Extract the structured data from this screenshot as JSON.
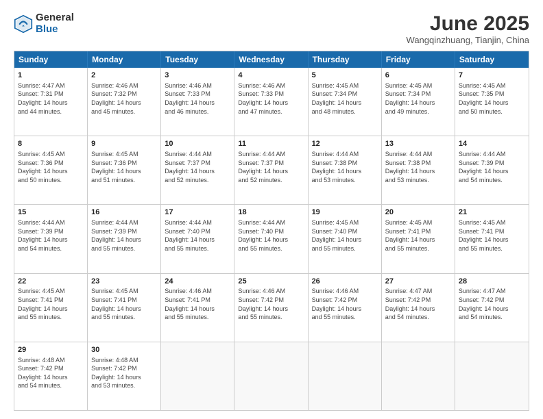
{
  "logo": {
    "general": "General",
    "blue": "Blue"
  },
  "title": "June 2025",
  "location": "Wangqinzhuang, Tianjin, China",
  "header_days": [
    "Sunday",
    "Monday",
    "Tuesday",
    "Wednesday",
    "Thursday",
    "Friday",
    "Saturday"
  ],
  "weeks": [
    [
      {
        "day": 1,
        "lines": [
          "Sunrise: 4:47 AM",
          "Sunset: 7:31 PM",
          "Daylight: 14 hours",
          "and 44 minutes."
        ]
      },
      {
        "day": 2,
        "lines": [
          "Sunrise: 4:46 AM",
          "Sunset: 7:32 PM",
          "Daylight: 14 hours",
          "and 45 minutes."
        ]
      },
      {
        "day": 3,
        "lines": [
          "Sunrise: 4:46 AM",
          "Sunset: 7:33 PM",
          "Daylight: 14 hours",
          "and 46 minutes."
        ]
      },
      {
        "day": 4,
        "lines": [
          "Sunrise: 4:46 AM",
          "Sunset: 7:33 PM",
          "Daylight: 14 hours",
          "and 47 minutes."
        ]
      },
      {
        "day": 5,
        "lines": [
          "Sunrise: 4:45 AM",
          "Sunset: 7:34 PM",
          "Daylight: 14 hours",
          "and 48 minutes."
        ]
      },
      {
        "day": 6,
        "lines": [
          "Sunrise: 4:45 AM",
          "Sunset: 7:34 PM",
          "Daylight: 14 hours",
          "and 49 minutes."
        ]
      },
      {
        "day": 7,
        "lines": [
          "Sunrise: 4:45 AM",
          "Sunset: 7:35 PM",
          "Daylight: 14 hours",
          "and 50 minutes."
        ]
      }
    ],
    [
      {
        "day": 8,
        "lines": [
          "Sunrise: 4:45 AM",
          "Sunset: 7:36 PM",
          "Daylight: 14 hours",
          "and 50 minutes."
        ]
      },
      {
        "day": 9,
        "lines": [
          "Sunrise: 4:45 AM",
          "Sunset: 7:36 PM",
          "Daylight: 14 hours",
          "and 51 minutes."
        ]
      },
      {
        "day": 10,
        "lines": [
          "Sunrise: 4:44 AM",
          "Sunset: 7:37 PM",
          "Daylight: 14 hours",
          "and 52 minutes."
        ]
      },
      {
        "day": 11,
        "lines": [
          "Sunrise: 4:44 AM",
          "Sunset: 7:37 PM",
          "Daylight: 14 hours",
          "and 52 minutes."
        ]
      },
      {
        "day": 12,
        "lines": [
          "Sunrise: 4:44 AM",
          "Sunset: 7:38 PM",
          "Daylight: 14 hours",
          "and 53 minutes."
        ]
      },
      {
        "day": 13,
        "lines": [
          "Sunrise: 4:44 AM",
          "Sunset: 7:38 PM",
          "Daylight: 14 hours",
          "and 53 minutes."
        ]
      },
      {
        "day": 14,
        "lines": [
          "Sunrise: 4:44 AM",
          "Sunset: 7:39 PM",
          "Daylight: 14 hours",
          "and 54 minutes."
        ]
      }
    ],
    [
      {
        "day": 15,
        "lines": [
          "Sunrise: 4:44 AM",
          "Sunset: 7:39 PM",
          "Daylight: 14 hours",
          "and 54 minutes."
        ]
      },
      {
        "day": 16,
        "lines": [
          "Sunrise: 4:44 AM",
          "Sunset: 7:39 PM",
          "Daylight: 14 hours",
          "and 55 minutes."
        ]
      },
      {
        "day": 17,
        "lines": [
          "Sunrise: 4:44 AM",
          "Sunset: 7:40 PM",
          "Daylight: 14 hours",
          "and 55 minutes."
        ]
      },
      {
        "day": 18,
        "lines": [
          "Sunrise: 4:44 AM",
          "Sunset: 7:40 PM",
          "Daylight: 14 hours",
          "and 55 minutes."
        ]
      },
      {
        "day": 19,
        "lines": [
          "Sunrise: 4:45 AM",
          "Sunset: 7:40 PM",
          "Daylight: 14 hours",
          "and 55 minutes."
        ]
      },
      {
        "day": 20,
        "lines": [
          "Sunrise: 4:45 AM",
          "Sunset: 7:41 PM",
          "Daylight: 14 hours",
          "and 55 minutes."
        ]
      },
      {
        "day": 21,
        "lines": [
          "Sunrise: 4:45 AM",
          "Sunset: 7:41 PM",
          "Daylight: 14 hours",
          "and 55 minutes."
        ]
      }
    ],
    [
      {
        "day": 22,
        "lines": [
          "Sunrise: 4:45 AM",
          "Sunset: 7:41 PM",
          "Daylight: 14 hours",
          "and 55 minutes."
        ]
      },
      {
        "day": 23,
        "lines": [
          "Sunrise: 4:45 AM",
          "Sunset: 7:41 PM",
          "Daylight: 14 hours",
          "and 55 minutes."
        ]
      },
      {
        "day": 24,
        "lines": [
          "Sunrise: 4:46 AM",
          "Sunset: 7:41 PM",
          "Daylight: 14 hours",
          "and 55 minutes."
        ]
      },
      {
        "day": 25,
        "lines": [
          "Sunrise: 4:46 AM",
          "Sunset: 7:42 PM",
          "Daylight: 14 hours",
          "and 55 minutes."
        ]
      },
      {
        "day": 26,
        "lines": [
          "Sunrise: 4:46 AM",
          "Sunset: 7:42 PM",
          "Daylight: 14 hours",
          "and 55 minutes."
        ]
      },
      {
        "day": 27,
        "lines": [
          "Sunrise: 4:47 AM",
          "Sunset: 7:42 PM",
          "Daylight: 14 hours",
          "and 54 minutes."
        ]
      },
      {
        "day": 28,
        "lines": [
          "Sunrise: 4:47 AM",
          "Sunset: 7:42 PM",
          "Daylight: 14 hours",
          "and 54 minutes."
        ]
      }
    ],
    [
      {
        "day": 29,
        "lines": [
          "Sunrise: 4:48 AM",
          "Sunset: 7:42 PM",
          "Daylight: 14 hours",
          "and 54 minutes."
        ]
      },
      {
        "day": 30,
        "lines": [
          "Sunrise: 4:48 AM",
          "Sunset: 7:42 PM",
          "Daylight: 14 hours",
          "and 53 minutes."
        ]
      },
      {
        "day": null,
        "lines": []
      },
      {
        "day": null,
        "lines": []
      },
      {
        "day": null,
        "lines": []
      },
      {
        "day": null,
        "lines": []
      },
      {
        "day": null,
        "lines": []
      }
    ]
  ]
}
